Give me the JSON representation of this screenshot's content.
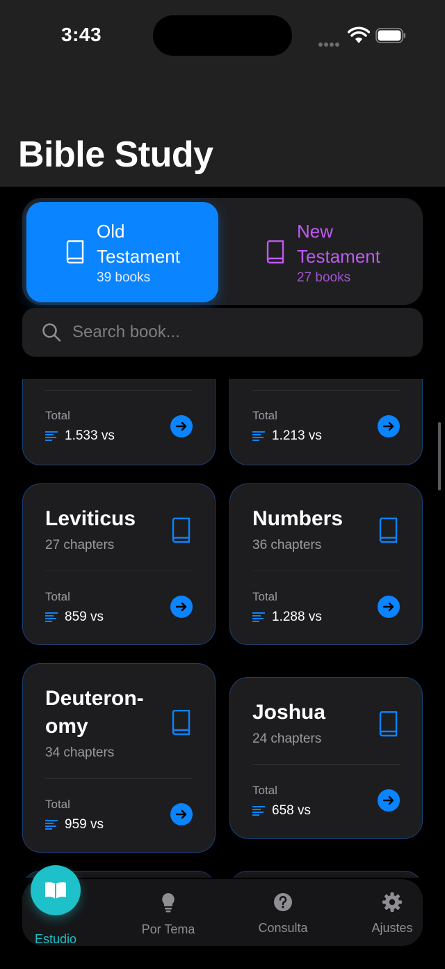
{
  "status_bar": {
    "time": "3:43"
  },
  "header": {
    "title": "Bible Study"
  },
  "testament_switch": {
    "old": {
      "label_line1": "Old",
      "label_line2": "Testament",
      "count": "39 books"
    },
    "new": {
      "label_line1": "New",
      "label_line2": "Testament",
      "count": "27 books"
    }
  },
  "search": {
    "placeholder": "Search book..."
  },
  "books": [
    {
      "name": "",
      "chapters": "",
      "total_label": "Total",
      "verses": "1.533 vs"
    },
    {
      "name": "",
      "chapters": "",
      "total_label": "Total",
      "verses": "1.213 vs"
    },
    {
      "name": "Leviticus",
      "chapters": "27 chapters",
      "total_label": "Total",
      "verses": "859 vs"
    },
    {
      "name": "Numbers",
      "chapters": "36 chapters",
      "total_label": "Total",
      "verses": "1.288 vs"
    },
    {
      "name_line1": "Deuteron-",
      "name_line2": "omy",
      "chapters": "34 chapters",
      "total_label": "Total",
      "verses": "959 vs"
    },
    {
      "name": "Joshua",
      "chapters": "24 chapters",
      "total_label": "Total",
      "verses": "658 vs"
    }
  ],
  "tab_bar": {
    "items": [
      {
        "label": "Estudio",
        "icon": "open-book-icon",
        "active": true
      },
      {
        "label": "Por Tema",
        "icon": "lightbulb-icon",
        "active": false
      },
      {
        "label": "Consulta",
        "icon": "question-circle-icon",
        "active": false
      },
      {
        "label": "Ajustes",
        "icon": "gear-icon",
        "active": false
      }
    ]
  },
  "colors": {
    "accent_blue": "#0a84ff",
    "accent_purple": "#bf5af2",
    "accent_teal": "#1ec1c9",
    "background": "#000000",
    "card": "#1d1d20"
  }
}
